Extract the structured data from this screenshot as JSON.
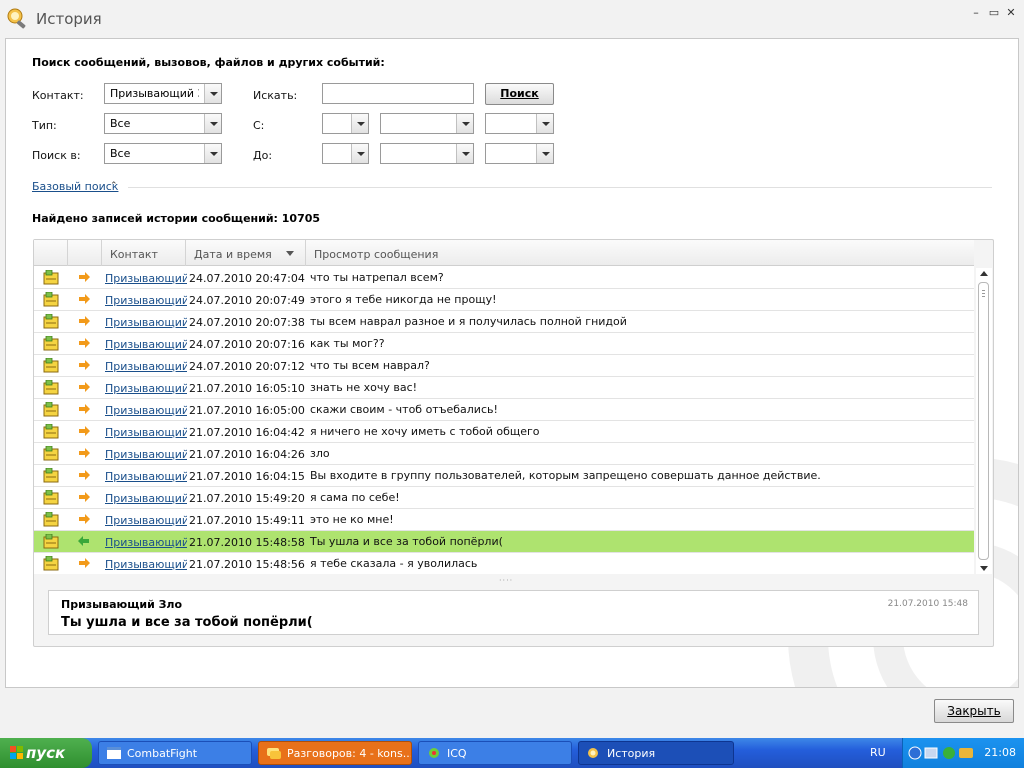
{
  "window": {
    "title": "История",
    "controls": {
      "minimize": "–",
      "maximize": "▭",
      "close": "✕"
    }
  },
  "search": {
    "heading": "Поиск сообщений, вызовов, файлов и других событий:",
    "contact_label": "Контакт:",
    "contact_value": "Призывающий Зло",
    "type_label": "Тип:",
    "type_value": "Все",
    "search_in_label": "Поиск в:",
    "search_in_value": "Все",
    "find_label": "Искать:",
    "find_value": "",
    "search_button": "Поиск",
    "from_label": "С:",
    "to_label": "До:",
    "basic_search_link": "Базовый поиск",
    "basic_search_arrow": "⌃"
  },
  "results": {
    "found_text": "Найдено записей истории сообщений: 10705"
  },
  "grid": {
    "columns": [
      "Контакт",
      "Дата и время",
      "Просмотр сообщения"
    ],
    "rows": [
      {
        "contact": "Призывающий Зло",
        "date": "24.07.2010 20:47:04",
        "message": "что ты натрепал всем?",
        "direction": "out"
      },
      {
        "contact": "Призывающий Зло",
        "date": "24.07.2010 20:07:49",
        "message": "этого я тебе никогда не прощу!",
        "direction": "out"
      },
      {
        "contact": "Призывающий Зло",
        "date": "24.07.2010 20:07:38",
        "message": "ты всем наврал разное и я получилась полной гнидой",
        "direction": "out"
      },
      {
        "contact": "Призывающий Зло",
        "date": "24.07.2010 20:07:16",
        "message": "как ты мог??",
        "direction": "out"
      },
      {
        "contact": "Призывающий Зло",
        "date": "24.07.2010 20:07:12",
        "message": "что ты всем наврал?",
        "direction": "out"
      },
      {
        "contact": "Призывающий Зло",
        "date": "21.07.2010 16:05:10",
        "message": "знать не хочу вас!",
        "direction": "out"
      },
      {
        "contact": "Призывающий Зло",
        "date": "21.07.2010 16:05:00",
        "message": "скажи своим - чтоб отъебались!",
        "direction": "out"
      },
      {
        "contact": "Призывающий Зло",
        "date": "21.07.2010 16:04:42",
        "message": "я ничего не хочу иметь с тобой общего",
        "direction": "out"
      },
      {
        "contact": "Призывающий Зло",
        "date": "21.07.2010 16:04:26",
        "message": "зло",
        "direction": "out"
      },
      {
        "contact": "Призывающий Зло",
        "date": "21.07.2010 16:04:15",
        "message": "Вы входите в группу пользователей, которым запрещено совершать данное действие.",
        "direction": "out"
      },
      {
        "contact": "Призывающий Зло",
        "date": "21.07.2010 15:49:20",
        "message": "я сама по себе!",
        "direction": "out"
      },
      {
        "contact": "Призывающий Зло",
        "date": "21.07.2010 15:49:11",
        "message": "это не ко мне!",
        "direction": "out"
      },
      {
        "contact": "Призывающий Зло",
        "date": "21.07.2010 15:48:58",
        "message": "Ты ушла и все за тобой попёрли(",
        "direction": "in",
        "selected": true
      },
      {
        "contact": "Призывающий Зло",
        "date": "21.07.2010 15:48:56",
        "message": "я тебе сказала - я уволилась",
        "direction": "out"
      }
    ]
  },
  "preview": {
    "name": "Призывающий Зло",
    "time": "21.07.2010 15:48",
    "text": "Ты ушла и все за тобой попёрли("
  },
  "close_button": "Закрыть",
  "taskbar": {
    "start": "пуск",
    "tasks": [
      {
        "label": "CombatFight"
      },
      {
        "label": "Разговоров: 4 - kons..."
      },
      {
        "label": "ICQ"
      },
      {
        "label": "История"
      }
    ],
    "lang": "RU",
    "clock": "21:08"
  },
  "colors": {
    "selected_row": "#aee36f",
    "link": "#1a4f8b",
    "taskbar": "#245edb",
    "start": "#2f8f2f"
  }
}
